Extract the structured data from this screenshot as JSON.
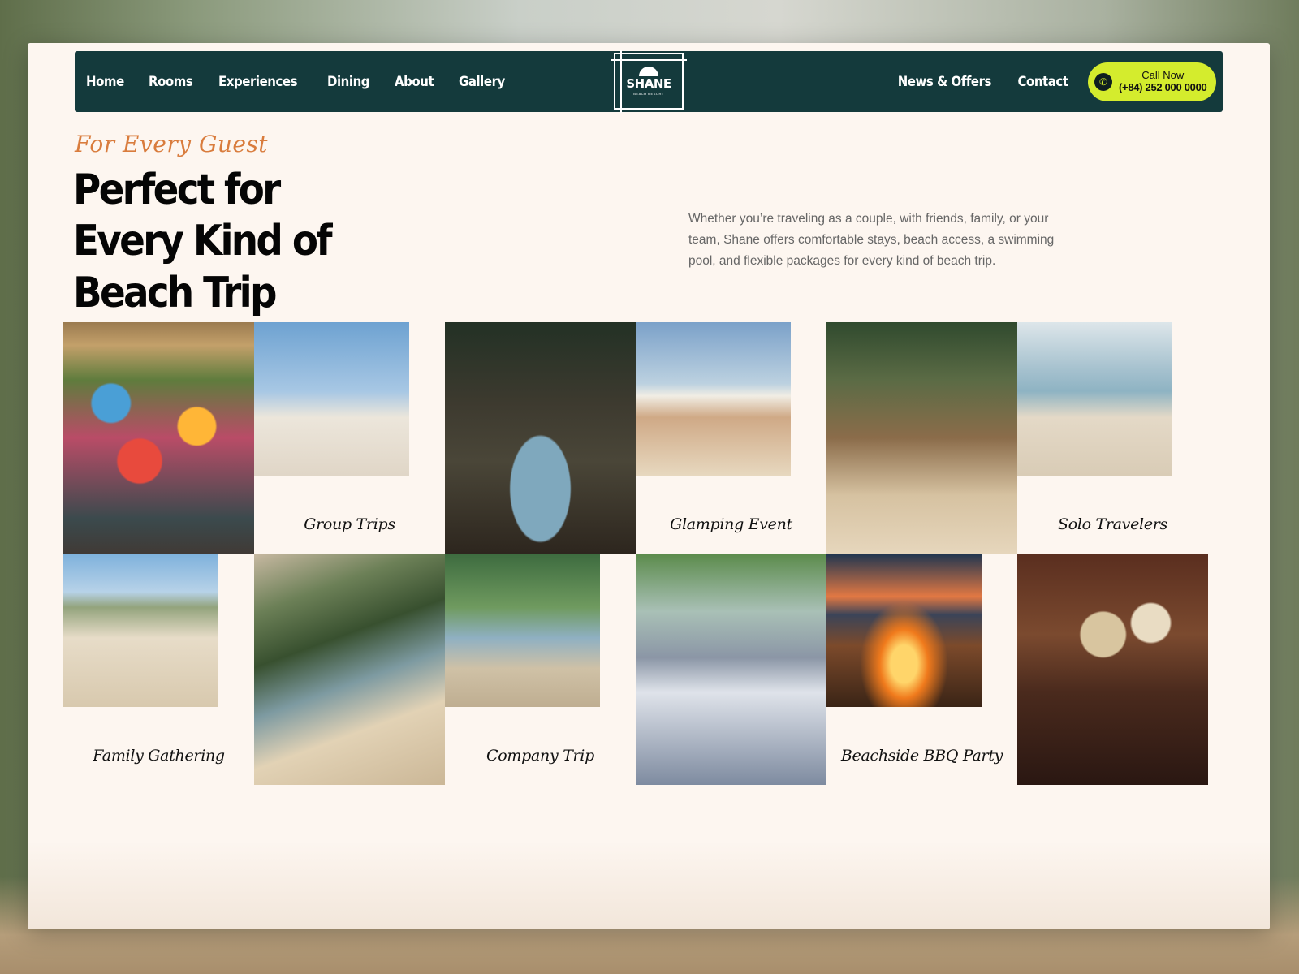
{
  "nav": {
    "left_links": [
      "Home",
      "Rooms",
      "Experiences",
      "Dining",
      "About",
      "Gallery"
    ],
    "right_links": [
      "News & Offers",
      "Contact"
    ],
    "logo_text": "SHANE",
    "logo_subtext": "BEACH RESORT",
    "call": {
      "label": "Call Now",
      "number": "(+84) 252 000 0000"
    }
  },
  "hero": {
    "kicker": "For Every Guest",
    "title": "Perfect for Every Kind of Beach Trip",
    "description": "Whether you’re traveling as a couple, with friends, family, or your team, Shane offers comfortable stays, beach access, a swimming pool, and flexible packages for every kind of beach trip."
  },
  "gallery": {
    "captions": {
      "group_trips": "Group Trips",
      "glamping_event": "Glamping Event",
      "solo_travelers": "Solo Travelers",
      "family_gathering": "Family Gathering",
      "company_trip": "Company Trip",
      "beachside_bbq": "Beachside BBQ Party"
    }
  },
  "colors": {
    "nav_bg": "#143a3c",
    "accent_lime": "#d4ec2d",
    "kicker_orange": "#d97c3d",
    "page_bg": "#fdf6f0"
  },
  "icons": {
    "phone": "phone-icon",
    "logo": "palm-sun-logo"
  }
}
